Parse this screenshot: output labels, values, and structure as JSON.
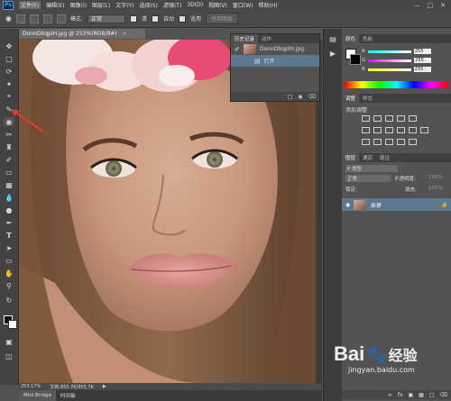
{
  "menubar": {
    "logo": "Ps",
    "items": [
      "文件(F)",
      "编辑(E)",
      "图像(I)",
      "图层(L)",
      "文字(Y)",
      "选择(S)",
      "滤镜(T)",
      "3D(D)",
      "视图(V)",
      "窗口(W)",
      "帮助(H)"
    ],
    "window_controls": [
      "—",
      "□",
      "✕"
    ]
  },
  "options": {
    "mode_label": "模式:",
    "mode_value": "正常",
    "check1": "清",
    "check2": "自动",
    "check3": "适用",
    "button": "使用图层"
  },
  "document": {
    "tab_title": "DonnDbqplH.jpg @ 253%(RGB/8#)",
    "close": "×",
    "zoom": "253.17%",
    "doc_size": "文档:955.7K/955.7K"
  },
  "bottom_tabs": [
    "Mini Bridge",
    "时间轴"
  ],
  "history": {
    "tabs": [
      "历史记录",
      "动作"
    ],
    "snapshot": "DonnDbqplH.jpg",
    "step": "打开"
  },
  "color_panel": {
    "tabs": [
      "颜色",
      "色板"
    ],
    "channels": [
      {
        "label": "R",
        "value": "255"
      },
      {
        "label": "G",
        "value": "255"
      },
      {
        "label": "B",
        "value": "255"
      }
    ]
  },
  "adjustments": {
    "tabs": [
      "调整",
      "样式"
    ],
    "title": "添加调整"
  },
  "layers": {
    "tabs": [
      "图层",
      "通道",
      "路径"
    ],
    "kind_label": "P 类型",
    "blend_mode": "正常",
    "opacity_label": "不透明度:",
    "opacity_value": "100%",
    "lock_label": "锁定:",
    "fill_label": "填充:",
    "fill_value": "100%",
    "layer_name": "背景"
  },
  "watermark": {
    "brand": "Bai",
    "brand2": "经验",
    "url": "jingyan.baidu.com"
  },
  "colors": {
    "accent": "#5f7891",
    "arrow": "#e63a2c"
  }
}
